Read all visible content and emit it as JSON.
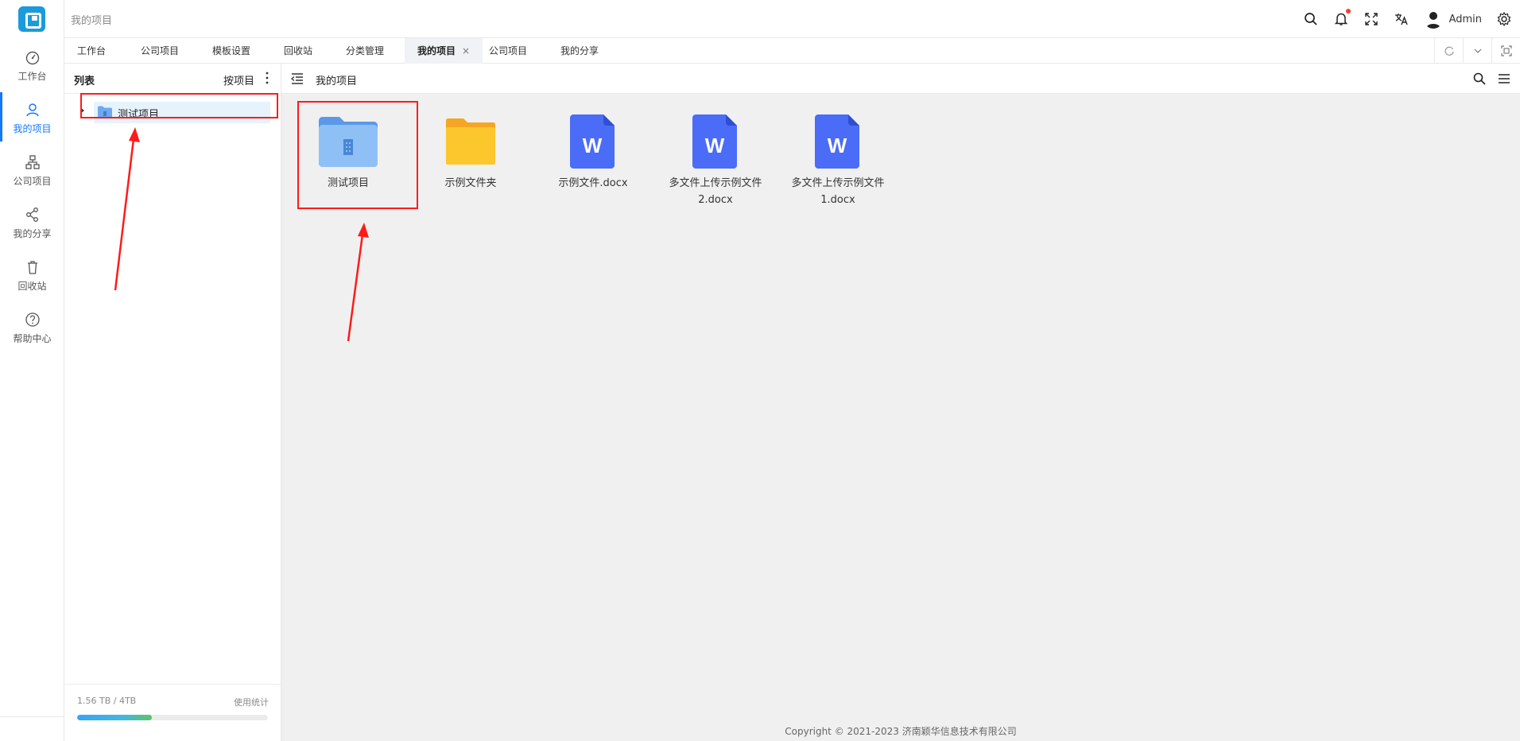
{
  "rail": {
    "items": [
      {
        "label": "工作台",
        "icon": "dashboard-icon"
      },
      {
        "label": "我的项目",
        "icon": "user-icon"
      },
      {
        "label": "公司项目",
        "icon": "org-chart-icon"
      },
      {
        "label": "我的分享",
        "icon": "share-icon"
      },
      {
        "label": "回收站",
        "icon": "trash-icon"
      },
      {
        "label": "帮助中心",
        "icon": "help-icon"
      }
    ],
    "active_index": 1
  },
  "header": {
    "breadcrumb": "我的项目",
    "user_name": "Admin"
  },
  "tabs": [
    {
      "label": "工作台"
    },
    {
      "label": "公司项目"
    },
    {
      "label": "模板设置"
    },
    {
      "label": "回收站"
    },
    {
      "label": "分类管理"
    },
    {
      "label": "我的项目",
      "active": true,
      "close": "×"
    },
    {
      "label": "公司项目"
    },
    {
      "label": "我的分享"
    }
  ],
  "list": {
    "title": "列表",
    "sort_label": "按项目",
    "tree": [
      {
        "label": "测试项目"
      }
    ]
  },
  "usage": {
    "text": "1.56 TB / 4TB",
    "link": "使用统计",
    "fraction": 0.39
  },
  "main": {
    "title": "我的项目",
    "files": [
      {
        "name": "测试项目",
        "type": "project-folder"
      },
      {
        "name": "示例文件夹",
        "type": "folder"
      },
      {
        "name": "示例文件.docx",
        "type": "word"
      },
      {
        "name": "多文件上传示例文件2.docx",
        "type": "word"
      },
      {
        "name": "多文件上传示例文件1.docx",
        "type": "word"
      }
    ]
  },
  "footer": {
    "copyright": "Copyright © 2021-2023 济南颖华信息技术有限公司"
  },
  "colors": {
    "accent": "#1677ff",
    "highlight": "#ff1a1a",
    "selected_row": "#e6f3fd",
    "word_blue": "#4a6cf7",
    "folder_yellow": "#fbc02d",
    "project_folder": "#6ea9ef"
  }
}
